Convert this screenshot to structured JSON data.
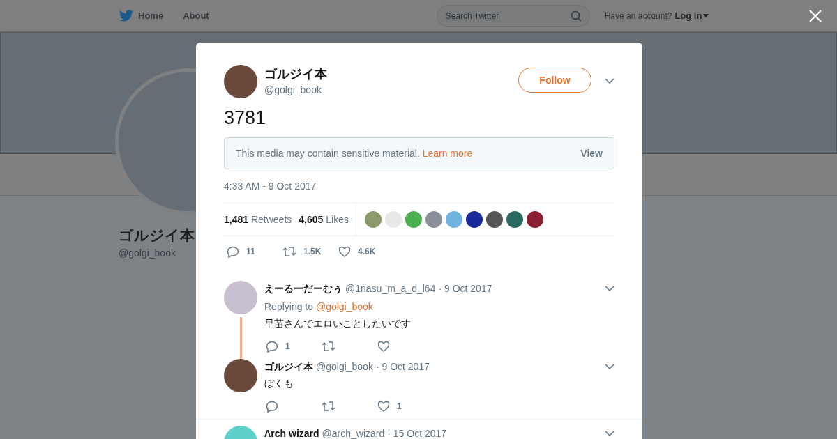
{
  "nav": {
    "home": "Home",
    "about": "About",
    "search_placeholder": "Search Twitter",
    "account_prompt": "Have an account?",
    "login": "Log in"
  },
  "background_profile": {
    "name": "ゴルジイ本",
    "handle": "@golgi_book"
  },
  "tweet": {
    "name": "ゴルジイ本",
    "handle": "@golgi_book",
    "follow": "Follow",
    "text": "3781",
    "sensitive": {
      "text": "This media may contain sensitive material.",
      "link": "Learn more",
      "action": "View"
    },
    "timestamp": "4:33 AM - 9 Oct 2017",
    "stats": {
      "retweets_count": "1,481",
      "retweets_label": "Retweets",
      "likes_count": "4,605",
      "likes_label": "Likes"
    },
    "likers": [
      {
        "color": "#8a9a6a"
      },
      {
        "color": "#e8e8e8"
      },
      {
        "color": "#4caf50"
      },
      {
        "color": "#8a8f99"
      },
      {
        "color": "#6fb3e0"
      },
      {
        "color": "#1a2a9a"
      },
      {
        "color": "#555555"
      },
      {
        "color": "#2a6a60"
      },
      {
        "color": "#8a2030"
      }
    ],
    "actions": {
      "replies": "11",
      "retweets": "1.5K",
      "likes": "4.6K"
    }
  },
  "replies": [
    {
      "name": "えーるーだーむぅ",
      "handle": "@1nasu_m_a_d_l64",
      "date": "· 9 Oct 2017",
      "color": "#c8bfd0",
      "replying_prefix": "Replying to",
      "replying_to": "@golgi_book",
      "text": "早苗さんでエロいことしたいです",
      "reply_count": "1",
      "thread_line": true
    },
    {
      "name": "ゴルジイ本",
      "handle": "@golgi_book",
      "date": "· 9 Oct 2017",
      "color": "#6a4a3a",
      "text": "ぼくも",
      "like_count": "1",
      "thread_line": false
    },
    {
      "name": "Λrch wizard",
      "handle": "@arch_wizard",
      "date": "· 15 Oct 2017",
      "color": "#5fd0c8",
      "thread_line": false
    }
  ]
}
